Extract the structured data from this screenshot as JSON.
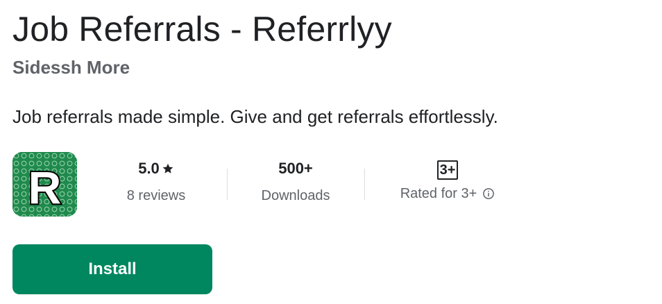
{
  "app": {
    "title": "Job Referrals - Referrlyy",
    "developer": "Sidessh More",
    "description": "Job referrals made simple. Give and get referrals effortlessly.",
    "icon_letter": "R",
    "icon_name": "app-icon-r",
    "icon_colors": {
      "background": "#1f8a4c",
      "letter": "#ffffff",
      "outline": "#000000"
    }
  },
  "stats": {
    "rating": {
      "value": "5.0",
      "star_icon": "star-icon",
      "label": "8 reviews"
    },
    "downloads": {
      "value": "500+",
      "label": "Downloads"
    },
    "content_rating": {
      "badge": "3+",
      "label": "Rated for 3+",
      "info_icon": "info-icon"
    }
  },
  "install": {
    "label": "Install",
    "color": "#01875f"
  }
}
